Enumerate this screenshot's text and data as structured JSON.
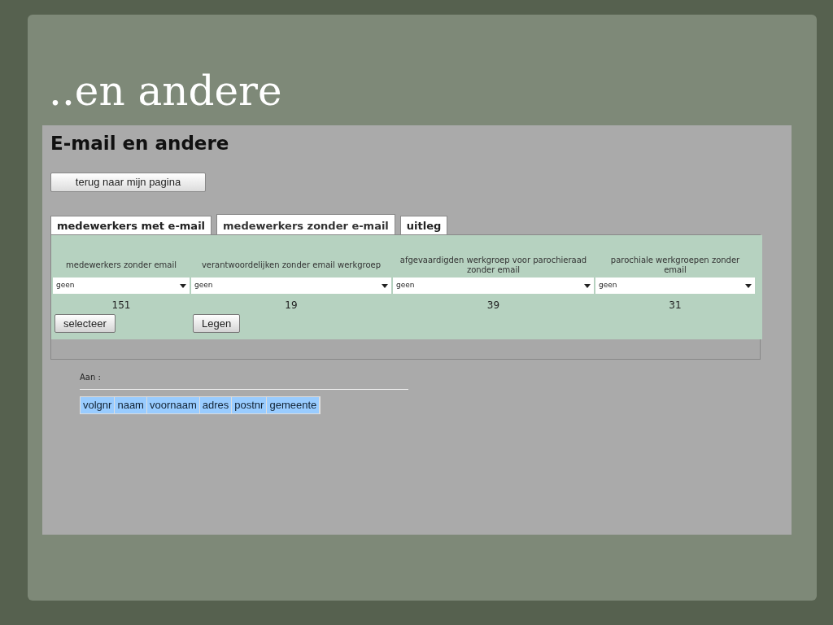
{
  "slide": {
    "title": "..en andere"
  },
  "page": {
    "heading": "E-mail en andere",
    "back_button": "terug naar mijn pagina",
    "tabs": [
      {
        "label": "medewerkers met e-mail",
        "selected": false
      },
      {
        "label": "medewerkers zonder e-mail",
        "selected": true
      },
      {
        "label": "uitleg",
        "selected": false
      }
    ],
    "groups": [
      {
        "label": "medewerkers zonder email",
        "value": "geen",
        "count": "151",
        "button": "selecteer"
      },
      {
        "label": "verantwoordelijken zonder email werkgroep",
        "value": "geen",
        "count": "19",
        "button": "Legen"
      },
      {
        "label": "afgevaardigden werkgroep voor parochieraad zonder email",
        "value": "geen",
        "count": "39"
      },
      {
        "label": "parochiale werkgroepen zonder email",
        "value": "geen",
        "count": "31"
      }
    ],
    "recipient_label": "Aan :",
    "table": {
      "columns": [
        "volgnr",
        "naam",
        "voornaam",
        "adres",
        "postnr",
        "gemeente"
      ]
    }
  }
}
